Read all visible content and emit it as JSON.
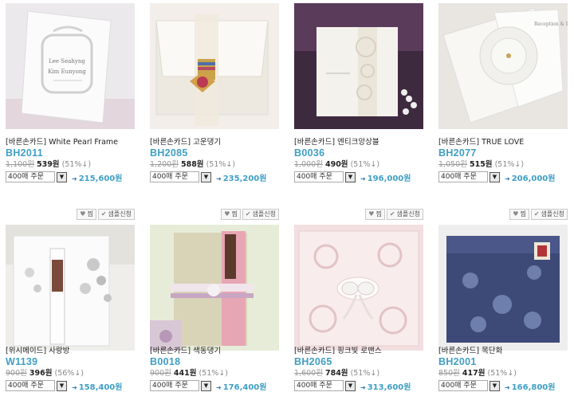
{
  "products": [
    {
      "name": "[바른손카드] White Pearl Frame",
      "code": "BH2011",
      "orig_price": "1,100원",
      "sale_price": "539원",
      "discount": "(51%↓)",
      "qty": "400매 주문",
      "total": "215,600원",
      "has_tools": false,
      "icon": "frame-invitation-photo"
    },
    {
      "name": "[바른손카드] 고운댕기",
      "code": "BH2085",
      "orig_price": "1,200원",
      "sale_price": "588원",
      "discount": "(51%↓)",
      "qty": "400매 주문",
      "total": "235,200원",
      "has_tools": false,
      "icon": "traditional-ribbon-invitation-photo"
    },
    {
      "name": "[바른손카드] 엔티크앙상블",
      "code": "B0036",
      "orig_price": "1,000원",
      "sale_price": "490원",
      "discount": "(51%↓)",
      "qty": "400매 주문",
      "total": "196,000원",
      "has_tools": false,
      "icon": "lace-invitation-photo"
    },
    {
      "name": "[바른손카드] TRUE LOVE",
      "code": "BH2077",
      "orig_price": "1,050원",
      "sale_price": "515원",
      "discount": "(51%↓)",
      "qty": "400매 주문",
      "total": "206,000원",
      "has_tools": false,
      "icon": "flower-invitation-photo"
    },
    {
      "name": "[위시메이드] 사랑방",
      "code": "W1139",
      "orig_price": "900원",
      "sale_price": "396원",
      "discount": "(56%↓)",
      "qty": "400매 주문",
      "total": "158,400원",
      "has_tools": true,
      "icon": "floral-window-invitation-photo"
    },
    {
      "name": "[바른손카드] 색동댕기",
      "code": "B0018",
      "orig_price": "900원",
      "sale_price": "441원",
      "discount": "(51%↓)",
      "qty": "400매 주문",
      "total": "176,400원",
      "has_tools": true,
      "icon": "stripe-ribbon-invitation-photo"
    },
    {
      "name": "[바른손카드] 핑크빛 로맨스",
      "code": "BH2065",
      "orig_price": "1,600원",
      "sale_price": "784원",
      "discount": "(51%↓)",
      "qty": "400매 주문",
      "total": "313,600원",
      "has_tools": true,
      "icon": "laser-cut-invitation-photo"
    },
    {
      "name": "[바른손카드] 목단화",
      "code": "BH2001",
      "orig_price": "850원",
      "sale_price": "417원",
      "discount": "(51%↓)",
      "qty": "400매 주문",
      "total": "166,800원",
      "has_tools": true,
      "icon": "navy-peony-invitation-photo"
    }
  ],
  "tools": {
    "wish_label": "찜",
    "sample_label": "샘플신청",
    "wish_icon": "heart-icon",
    "sample_icon": "check-icon"
  },
  "colors": {
    "code": "#3f9fc6",
    "total": "#3f9fc6",
    "original_price": "#999999"
  }
}
